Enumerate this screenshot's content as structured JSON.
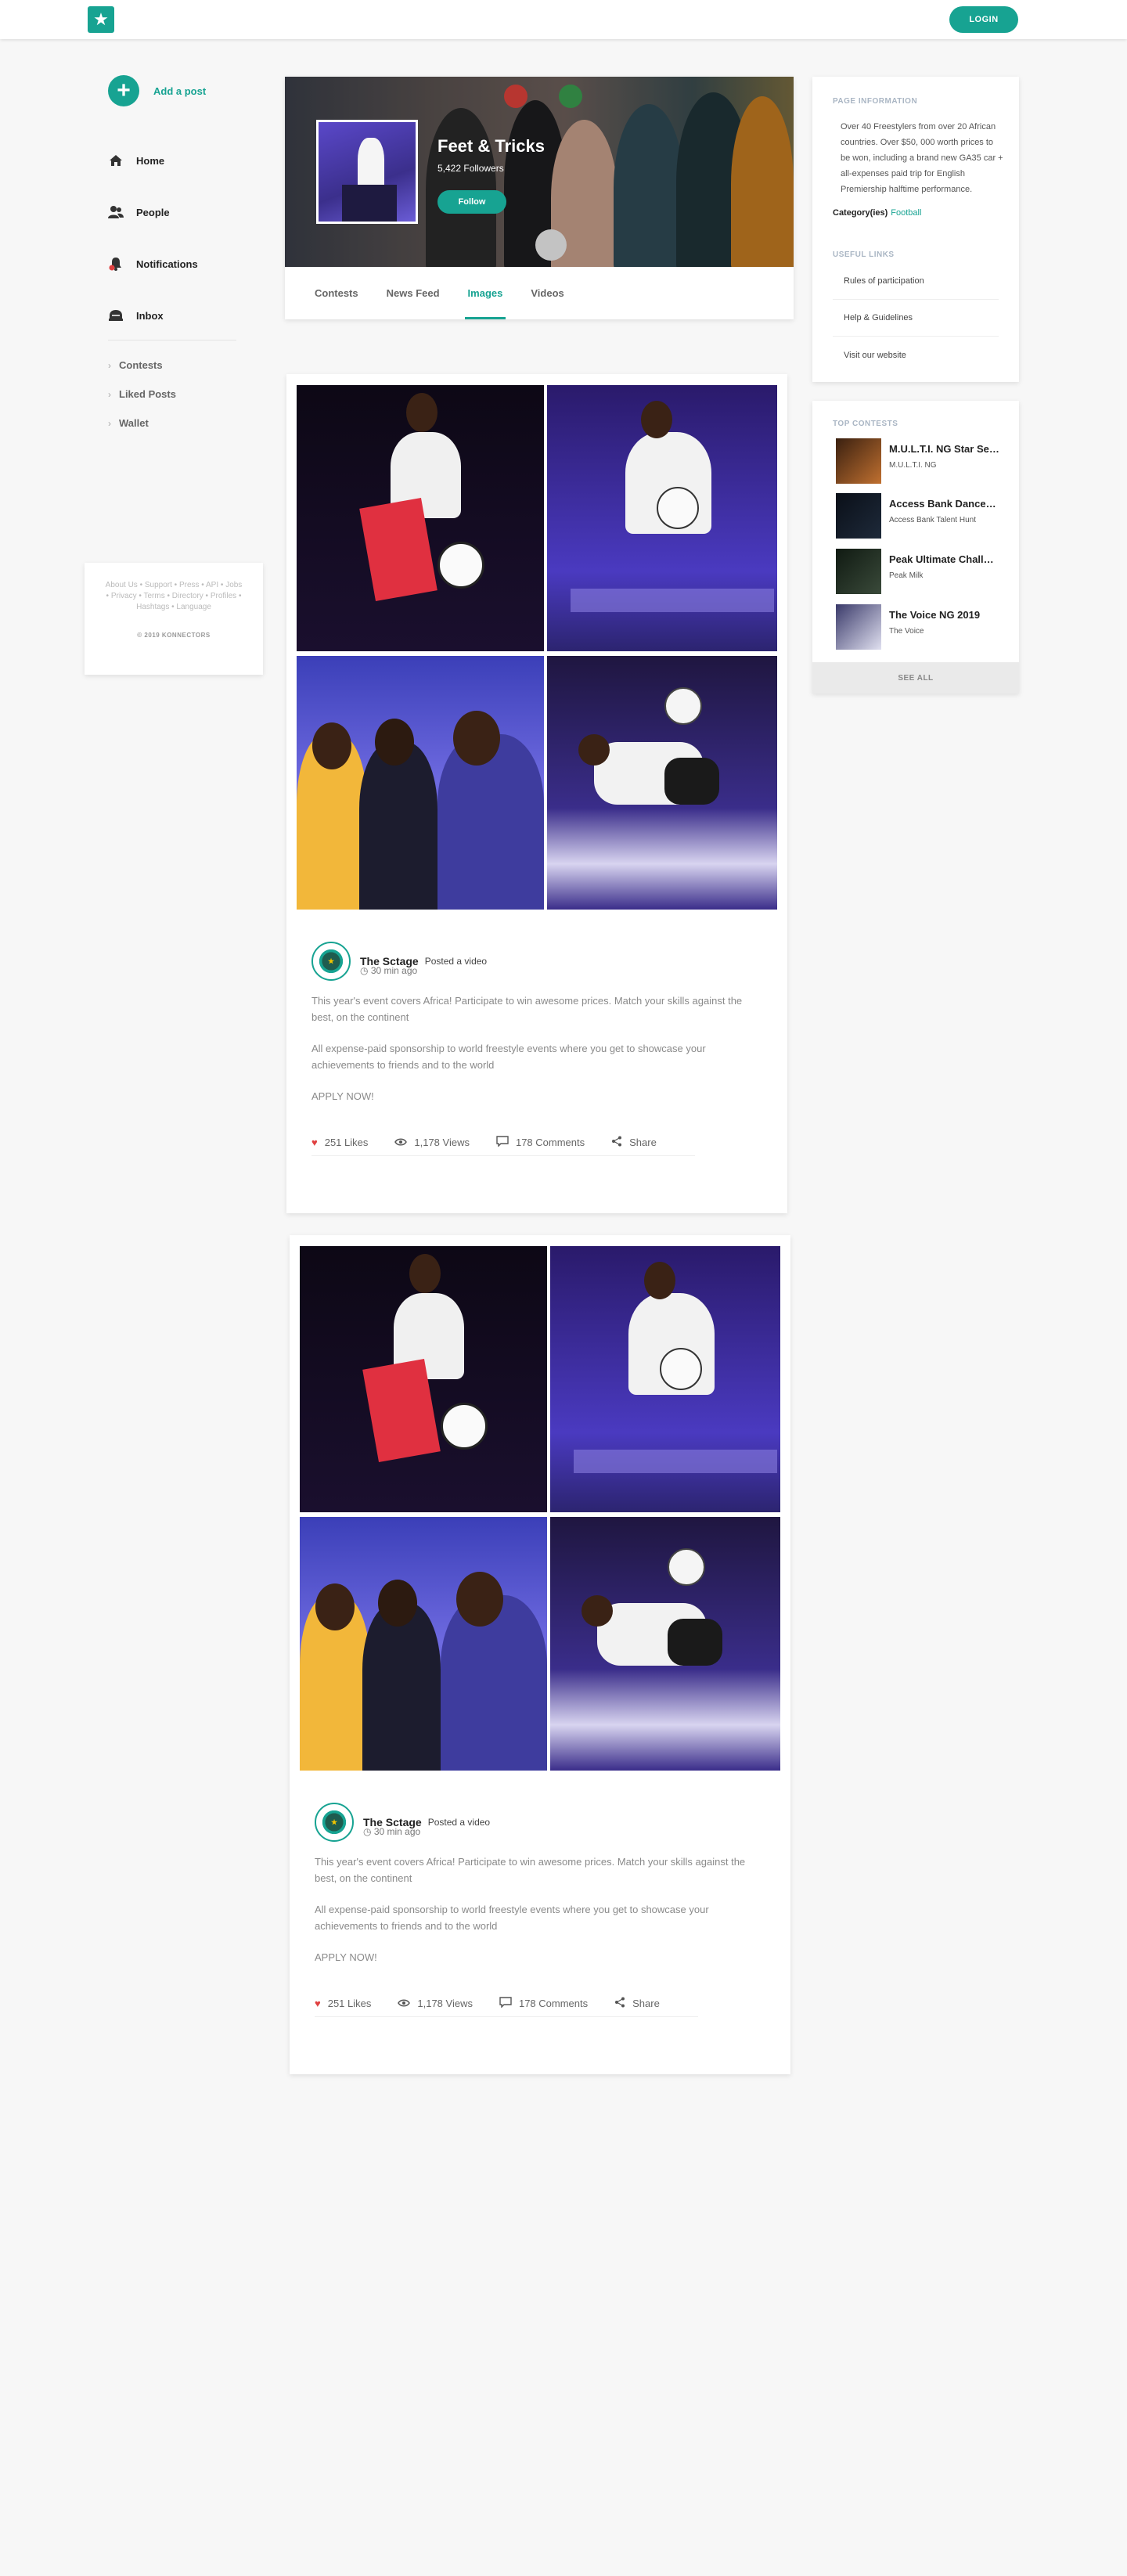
{
  "topbar": {
    "login_label": "LOGIN",
    "logo_icon": "star-logo-icon"
  },
  "sidebar": {
    "add_post_label": "Add a post",
    "nav": [
      {
        "label": "Home",
        "icon": "home-icon"
      },
      {
        "label": "People",
        "icon": "people-icon"
      },
      {
        "label": "Notifications",
        "icon": "bell-icon"
      },
      {
        "label": "Inbox",
        "icon": "inbox-icon"
      }
    ],
    "links": [
      {
        "label": "Contests"
      },
      {
        "label": "Liked Posts"
      },
      {
        "label": "Wallet"
      }
    ],
    "footer_links": "About Us • Support • Press • API • Jobs • Privacy • Terms • Directory • Profiles • Hashtags • Language",
    "copyright": "© 2019 KONNECTORS"
  },
  "page": {
    "name": "Feet & Tricks",
    "followers": "5,422 Followers",
    "follow_label": "Follow",
    "tabs": [
      {
        "label": "Contests"
      },
      {
        "label": "News Feed"
      },
      {
        "label": "Images",
        "active": true
      },
      {
        "label": "Videos"
      }
    ]
  },
  "posts": [
    {
      "author": "The Sctage",
      "action": "Posted a video",
      "time": "30 min ago",
      "paragraphs": [
        "This year's event covers Africa! Participate to win awesome prices. Match your skills against the best, on the continent",
        "All expense-paid sponsorship to world freestyle events where you get to showcase your achievements to friends and to the world",
        "APPLY NOW!"
      ],
      "likes": "251 Likes",
      "views": "1,178 Views",
      "comments": "178 Comments",
      "share": "Share"
    },
    {
      "author": "The Sctage",
      "action": "Posted a video",
      "time": "30 min ago",
      "paragraphs": [
        "This year's event covers Africa! Participate to win awesome prices. Match your skills against the best, on the continent",
        "All expense-paid sponsorship to world freestyle events where you get to showcase your achievements to friends and to the world",
        "APPLY NOW!"
      ],
      "likes": "251 Likes",
      "views": "1,178 Views",
      "comments": "178 Comments",
      "share": "Share"
    }
  ],
  "page_info": {
    "title": "PAGE INFORMATION",
    "description": "Over 40 Freestylers from over 20 African countries. Over $50, 000 worth prices to be won, including a brand new GA35 car + all-expenses paid trip for English Premiership halftime performance.",
    "category_label": "Category(ies)",
    "category_value": "Football",
    "useful_links_title": "USEFUL LINKS",
    "useful_links": [
      "Rules of participation",
      "Help & Guidelines",
      "Visit our website"
    ]
  },
  "top_contests": {
    "title": "TOP CONTESTS",
    "items": [
      {
        "title": "M.U.L.T.I. NG Star Se…",
        "sub": "M.U.L.T.I. NG"
      },
      {
        "title": "Access Bank Dance…",
        "sub": "Access Bank Talent Hunt"
      },
      {
        "title": "Peak Ultimate Chall…",
        "sub": "Peak Milk"
      },
      {
        "title": "The Voice NG 2019",
        "sub": "The Voice"
      }
    ],
    "see_all": "SEE ALL"
  }
}
